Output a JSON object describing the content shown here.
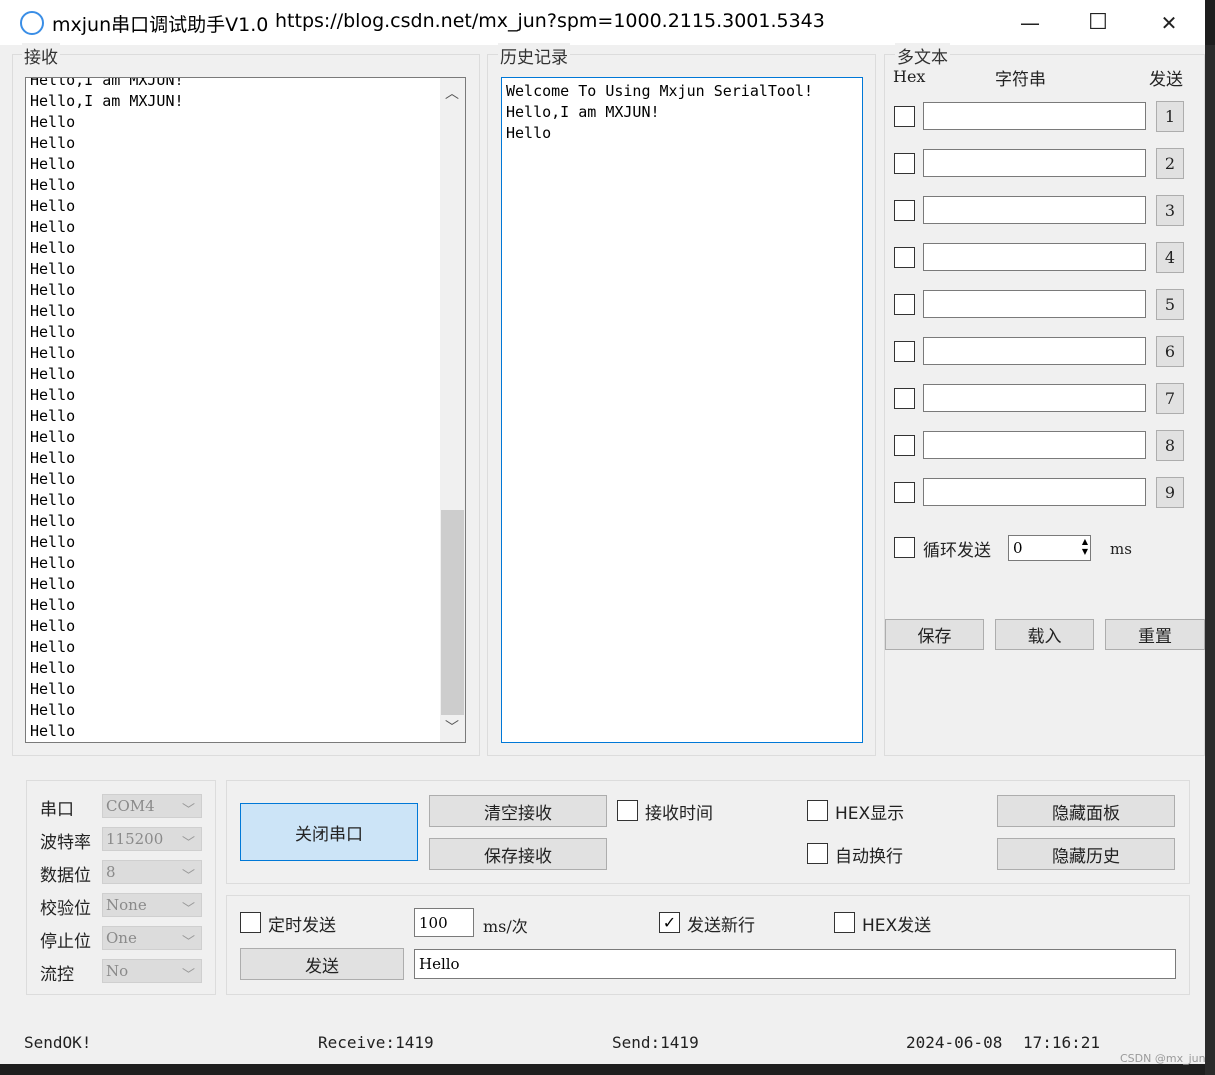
{
  "window": {
    "title": "mxjun串口调试助手V1.0",
    "url": "https://blog.csdn.net/mx_jun?spm=1000.2115.3001.5343",
    "minimize_glyph": "—",
    "maximize_glyph": "☐",
    "close_glyph": "✕"
  },
  "receive": {
    "label": "接收",
    "partial_line": "Hello,I am MXJUN!",
    "lines": [
      "Hello,I am MXJUN!",
      "Hello",
      "Hello",
      "Hello",
      "Hello",
      "Hello",
      "Hello",
      "Hello",
      "Hello",
      "Hello",
      "Hello",
      "Hello",
      "Hello",
      "Hello",
      "Hello",
      "Hello",
      "Hello",
      "Hello",
      "Hello",
      "Hello",
      "Hello",
      "Hello",
      "Hello",
      "Hello",
      "Hello",
      "Hello",
      "Hello",
      "Hello",
      "Hello",
      "Hello",
      "Hello"
    ]
  },
  "history": {
    "label": "历史记录",
    "lines": [
      "Welcome To Using Mxjun SerialTool!",
      "Hello,I am MXJUN!",
      "Hello"
    ]
  },
  "multi": {
    "label": "多文本",
    "col_hex": "Hex",
    "col_string": "字符串",
    "col_send": "发送",
    "rows": [
      {
        "num": "1",
        "value": ""
      },
      {
        "num": "2",
        "value": ""
      },
      {
        "num": "3",
        "value": ""
      },
      {
        "num": "4",
        "value": ""
      },
      {
        "num": "5",
        "value": ""
      },
      {
        "num": "6",
        "value": ""
      },
      {
        "num": "7",
        "value": ""
      },
      {
        "num": "8",
        "value": ""
      },
      {
        "num": "9",
        "value": ""
      }
    ],
    "loop_label": "循环发送",
    "loop_value": "0",
    "loop_unit": "ms",
    "save": "保存",
    "load": "载入",
    "reset": "重置"
  },
  "serial": {
    "port_label": "串口",
    "port_value": "COM4",
    "baud_label": "波特率",
    "baud_value": "115200",
    "data_label": "数据位",
    "data_value": "8",
    "parity_label": "校验位",
    "parity_value": "None",
    "stop_label": "停止位",
    "stop_value": "One",
    "flow_label": "流控",
    "flow_value": "No"
  },
  "controls": {
    "close_port": "关闭串口",
    "clear_receive": "清空接收",
    "save_receive": "保存接收",
    "receive_time": "接收时间",
    "hex_display": "HEX显示",
    "auto_wrap": "自动换行",
    "hide_panel": "隐藏面板",
    "hide_history": "隐藏历史"
  },
  "send": {
    "timed_send": "定时发送",
    "interval_value": "100",
    "interval_unit": "ms/次",
    "send_newline": "发送新行",
    "send_newline_checked": "✓",
    "hex_send": "HEX发送",
    "send_button": "发送",
    "send_text": "Hello"
  },
  "status": {
    "state": "SendOK!",
    "receive": "Receive:1419",
    "send": "Send:1419",
    "date": "2024-06-08",
    "time": "17:16:21"
  },
  "watermark": "CSDN @mx_jun",
  "colors": {
    "accent": "#0078d7",
    "primary_button_bg": "#cce4f7",
    "window_bg": "#f0f0f0"
  }
}
